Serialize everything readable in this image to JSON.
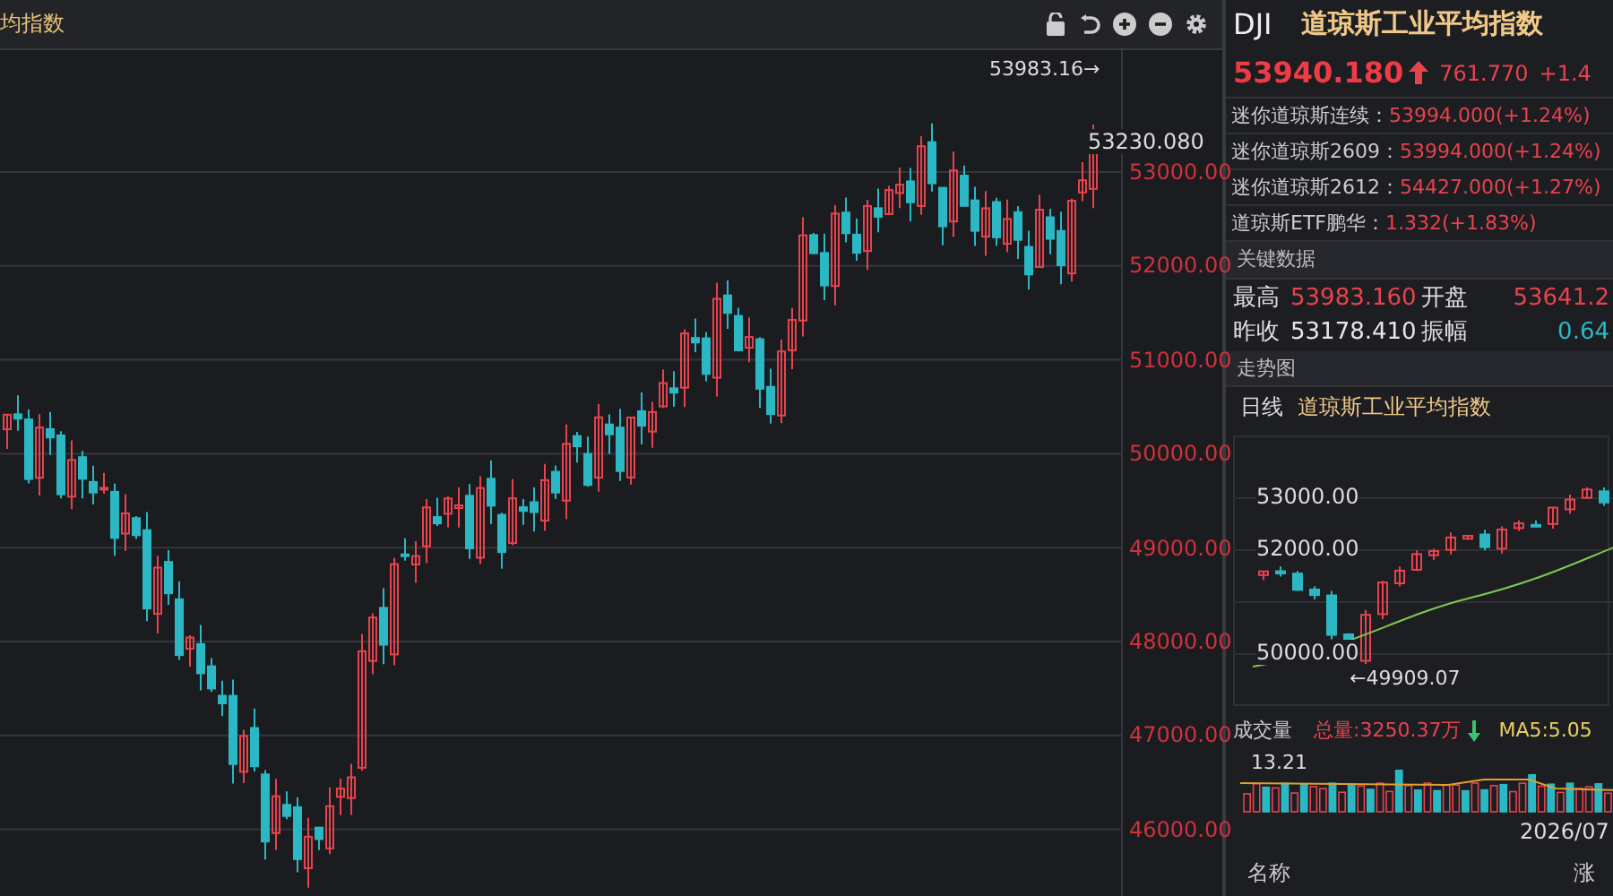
{
  "toolbar": {
    "title": "均指数"
  },
  "main_chart": {
    "y_labels": [
      "53000.00",
      "52000.00",
      "51000.00",
      "50000.00",
      "49000.00",
      "48000.00",
      "47000.00",
      "46000.00"
    ],
    "high_marker": "53983.16→",
    "last_price": "53230.080"
  },
  "quote": {
    "symbol": "DJI",
    "name": "道琼斯工业平均指数",
    "price": "53940.180",
    "change": "761.770",
    "change_pct": "+1.4"
  },
  "related": [
    {
      "label": "迷你道琼斯连续：",
      "value": "53994.000(+1.24%)"
    },
    {
      "label": "迷你道琼斯2609：",
      "value": "53994.000(+1.24%)"
    },
    {
      "label": "迷你道琼斯2612：",
      "value": "54427.000(+1.27%)"
    },
    {
      "label": "道琼斯ETF鹏华：",
      "value": "1.332(+1.83%)"
    }
  ],
  "key_data": {
    "title": "关键数据",
    "items": [
      {
        "label": "最高",
        "value": "53983.160",
        "color": "#e8434d"
      },
      {
        "label": "开盘",
        "value": "53641.2",
        "color": "#e8434d"
      },
      {
        "label": "昨收",
        "value": "53178.410",
        "color": "#e6e6e6"
      },
      {
        "label": "振幅",
        "value": "0.64",
        "color": "#2bb8c4"
      }
    ]
  },
  "trend": {
    "title": "走势图",
    "period": "日线",
    "name": "道琼斯工业平均指数",
    "y_labels": [
      "53000.00",
      "52000.00",
      "50000.00"
    ],
    "low_marker": "←49909.07"
  },
  "volume": {
    "title": "成交量",
    "total": "总量:3250.37万",
    "ma5": "MA5:5.05",
    "max": "13.21",
    "date": "2026/07"
  },
  "list_header": [
    "名称",
    "涨"
  ]
}
